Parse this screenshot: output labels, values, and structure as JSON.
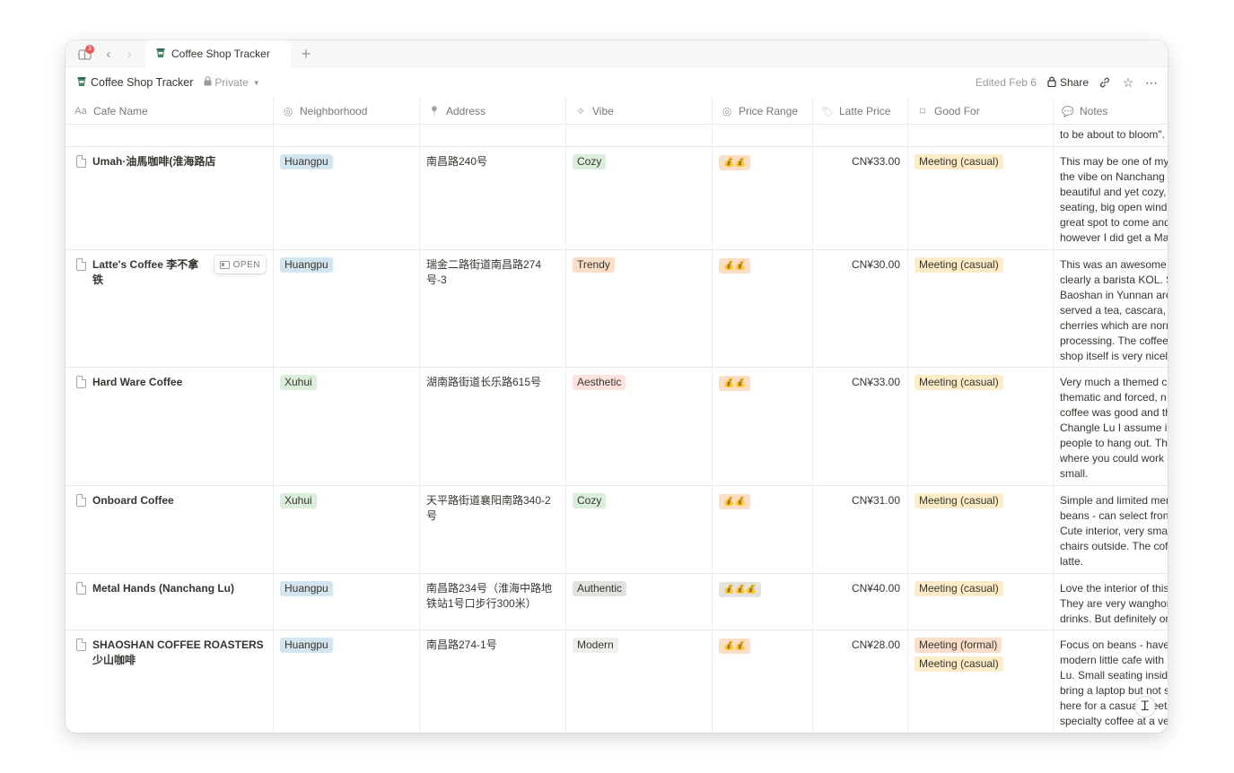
{
  "tabbar": {
    "notification_count": "3",
    "tab_title": "Coffee Shop Tracker",
    "new_tab": "+"
  },
  "topbar": {
    "page_title": "Coffee Shop Tracker",
    "privacy": "Private",
    "edited": "Edited Feb 6",
    "share": "Share"
  },
  "table": {
    "columns": [
      {
        "label": "Cafe Name",
        "icon": "title-icon"
      },
      {
        "label": "Neighborhood",
        "icon": "select-icon"
      },
      {
        "label": "Address",
        "icon": "pin-icon"
      },
      {
        "label": "Vibe",
        "icon": "magic-wand-icon"
      },
      {
        "label": "Price Range",
        "icon": "select-icon"
      },
      {
        "label": "Latte Price",
        "icon": "tag-icon"
      },
      {
        "label": "Good For",
        "icon": "bookmark-icon"
      },
      {
        "label": "Notes",
        "icon": "speech-bubble-icon"
      }
    ],
    "partial_row_notes": "to be about to bloom\".",
    "open_label": "OPEN",
    "rows": [
      {
        "name": "Umah·油馬咖啡(淮海路店",
        "neighborhood": "Huangpu",
        "address": "南昌路240号",
        "vibe": "Cozy",
        "price_range": "💰💰",
        "latte_price": "CN¥33.00",
        "good_for": [
          "Meeting (casual)"
        ],
        "notes": [
          "This may be one of my",
          "the vibe on Nanchang",
          "beautiful and yet cozy,",
          "seating, big open wind",
          "great spot to come and",
          "however I did get a Ma"
        ]
      },
      {
        "name": "Latte's Coffee 李不拿铁",
        "neighborhood": "Huangpu",
        "address": "瑞金二路街道南昌路274号-3",
        "vibe": "Trendy",
        "price_range": "💰💰",
        "latte_price": "CN¥30.00",
        "good_for": [
          "Meeting (casual)"
        ],
        "notes": [
          "This was an awesome c",
          "clearly a barista KOL. S",
          "Baoshan in Yunnan are",
          "served a tea, cascara,",
          "cherries which are norm",
          "processing. The coffee",
          "shop itself is very nicel"
        ]
      },
      {
        "name": "Hard Ware Coffee",
        "neighborhood": "Xuhui",
        "address": "湖南路街道长乐路615号",
        "vibe": "Aesthetic",
        "price_range": "💰💰",
        "latte_price": "CN¥33.00",
        "good_for": [
          "Meeting (casual)"
        ],
        "notes": [
          "Very much a themed co",
          "thematic and forced, n",
          "coffee was good and th",
          "Changle Lu I assume it",
          "people to hang out. Th",
          "where you could work c",
          "small."
        ]
      },
      {
        "name": "Onboard Coffee",
        "neighborhood": "Xuhui",
        "address": "天平路街道襄阳南路340-2号",
        "vibe": "Cozy",
        "price_range": "💰💰",
        "latte_price": "CN¥31.00",
        "good_for": [
          "Meeting (casual)"
        ],
        "notes": [
          "Simple and limited mer",
          "beans - can select fron",
          "Cute interior, very sma",
          "chairs outside. The cof",
          "latte."
        ]
      },
      {
        "name": "Metal Hands (Nanchang Lu)",
        "neighborhood": "Huangpu",
        "address": "南昌路234号（淮海中路地铁站1号口步行300米）",
        "vibe": "Authentic",
        "price_range": "💰💰💰",
        "latte_price": "CN¥40.00",
        "good_for": [
          "Meeting (casual)"
        ],
        "notes": [
          "Love the interior of this",
          "They are very wanghor",
          "drinks. But definitely or"
        ]
      },
      {
        "name": "SHAOSHAN COFFEE ROASTERS 少山咖啡",
        "neighborhood": "Huangpu",
        "address": "南昌路274-1号",
        "vibe": "Modern",
        "price_range": "💰💰",
        "latte_price": "CN¥28.00",
        "good_for": [
          "Meeting (formal)",
          "Meeting (casual)"
        ],
        "notes": [
          "Focus on beans - have",
          "modern little cafe with",
          "Lu. Small seating inside",
          "bring a laptop but not s",
          "here for a casual meeti",
          "specialty coffee at a ve"
        ]
      }
    ]
  },
  "colors": {
    "huangpu": "#d3e5ef",
    "xuhui": "#dbeddb",
    "cozy": "#dbeddb",
    "trendy": "#fadec9",
    "aesthetic": "#ffe2dd",
    "authentic": "#e3e2e0",
    "modern": "#eeeeec",
    "price_range": "#fadec9",
    "price_range_3": "#e3e2e0",
    "meeting_casual": "#fdecc8",
    "meeting_formal": "#fadec9"
  }
}
